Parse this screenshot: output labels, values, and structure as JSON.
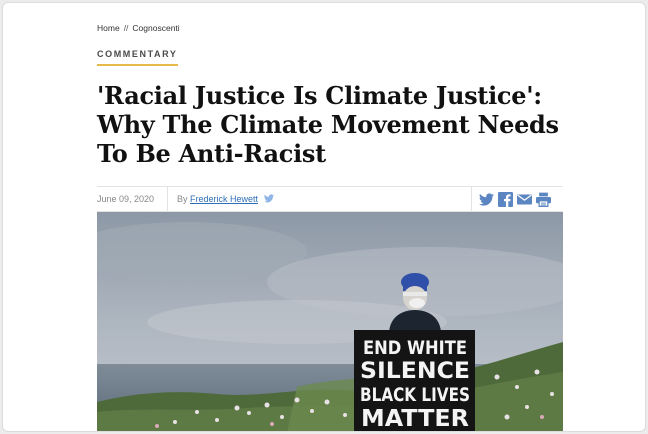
{
  "breadcrumb": {
    "home": "Home",
    "separator": "//",
    "section": "Cognoscenti"
  },
  "kicker": "COMMENTARY",
  "headline": {
    "line1": "'Racial Justice Is Climate Justice':",
    "line2": "Why The Climate Movement Needs",
    "line3": "To Be Anti-Racist"
  },
  "meta": {
    "date": "June 09, 2020",
    "by_prefix": "By",
    "author": "Frederick Hewett"
  },
  "share_icons": [
    "twitter-icon",
    "facebook-icon",
    "email-icon",
    "print-icon"
  ],
  "photo": {
    "sign_lines": [
      "END WHITE",
      "SILENCE",
      "BLACK LIVES",
      "MATTER"
    ]
  },
  "colors": {
    "accent": "#e7b84a",
    "link": "#2f6fb6",
    "share": "#5b86c1"
  }
}
